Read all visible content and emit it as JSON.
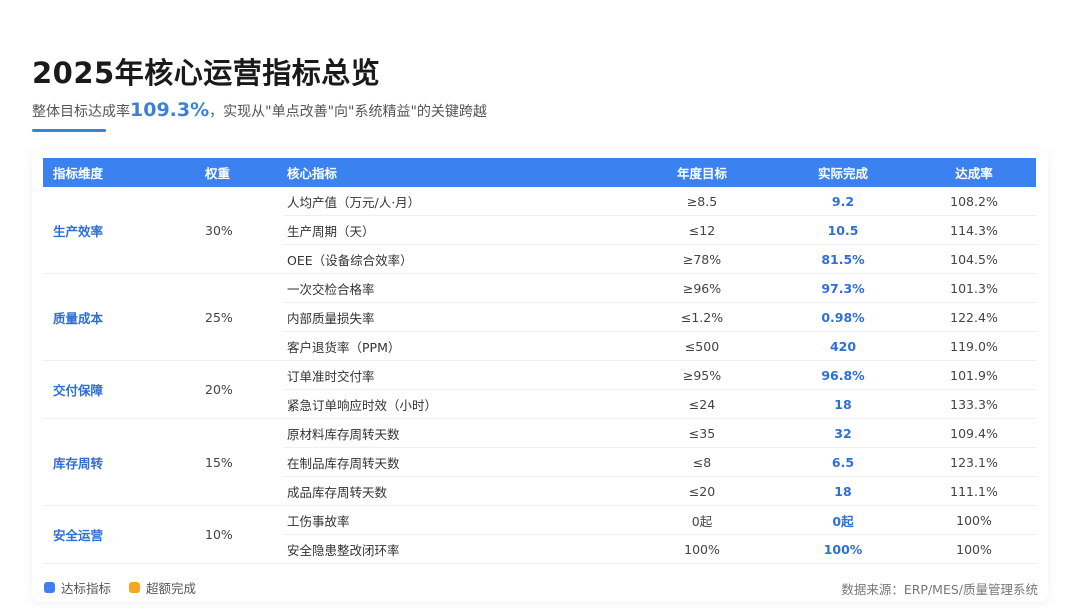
{
  "header": {
    "title": "2025年核心运营指标总览",
    "subtitle_prefix": "整体目标达成率",
    "subtitle_rate": "109.3%",
    "subtitle_suffix": "，实现从\"单点改善\"向\"系统精益\"的关键跨越"
  },
  "table": {
    "headers": [
      "指标维度",
      "权重",
      "核心指标",
      "年度目标",
      "实际完成",
      "达成率"
    ],
    "groups": [
      {
        "dimension": "生产效率",
        "weight": "30%",
        "rows": [
          {
            "indicator": "人均产值（万元/人·月）",
            "target": "≥8.5",
            "actual": "9.2",
            "rate": "108.2%"
          },
          {
            "indicator": "生产周期（天）",
            "target": "≤12",
            "actual": "10.5",
            "rate": "114.3%"
          },
          {
            "indicator": "OEE（设备综合效率）",
            "target": "≥78%",
            "actual": "81.5%",
            "rate": "104.5%"
          }
        ]
      },
      {
        "dimension": "质量成本",
        "weight": "25%",
        "rows": [
          {
            "indicator": "一次交检合格率",
            "target": "≥96%",
            "actual": "97.3%",
            "rate": "101.3%"
          },
          {
            "indicator": "内部质量损失率",
            "target": "≤1.2%",
            "actual": "0.98%",
            "rate": "122.4%"
          },
          {
            "indicator": "客户退货率（PPM）",
            "target": "≤500",
            "actual": "420",
            "rate": "119.0%"
          }
        ]
      },
      {
        "dimension": "交付保障",
        "weight": "20%",
        "rows": [
          {
            "indicator": "订单准时交付率",
            "target": "≥95%",
            "actual": "96.8%",
            "rate": "101.9%"
          },
          {
            "indicator": "紧急订单响应时效（小时）",
            "target": "≤24",
            "actual": "18",
            "rate": "133.3%"
          }
        ]
      },
      {
        "dimension": "库存周转",
        "weight": "15%",
        "rows": [
          {
            "indicator": "原材料库存周转天数",
            "target": "≤35",
            "actual": "32",
            "rate": "109.4%"
          },
          {
            "indicator": "在制品库存周转天数",
            "target": "≤8",
            "actual": "6.5",
            "rate": "123.1%"
          },
          {
            "indicator": "成品库存周转天数",
            "target": "≤20",
            "actual": "18",
            "rate": "111.1%"
          }
        ]
      },
      {
        "dimension": "安全运营",
        "weight": "10%",
        "rows": [
          {
            "indicator": "工伤事故率",
            "target": "0起",
            "actual": "0起",
            "rate": "100%"
          },
          {
            "indicator": "安全隐患整改闭环率",
            "target": "100%",
            "actual": "100%",
            "rate": "100%"
          }
        ]
      }
    ]
  },
  "legend": [
    {
      "label": "达标指标",
      "color": "#3b82f0"
    },
    {
      "label": "超额完成",
      "color": "#f5a623"
    }
  ],
  "footer": {
    "source": "数据来源：ERP/MES/质量管理系统"
  }
}
